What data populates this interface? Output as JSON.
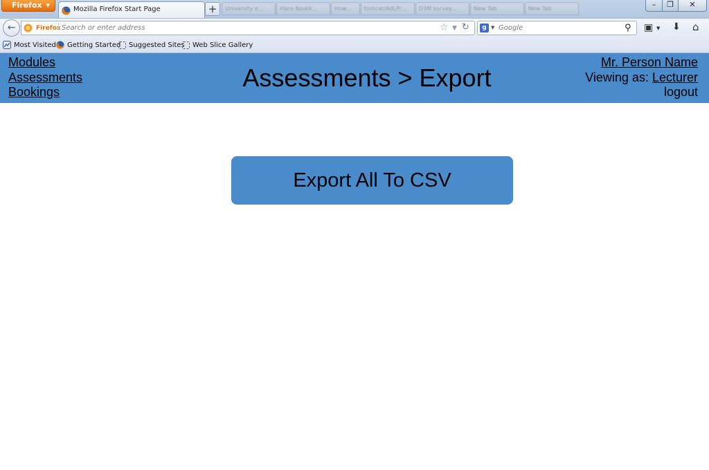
{
  "browser": {
    "menu_button_label": "Firefox",
    "active_tab_title": "Mozilla Firefox Start Page",
    "background_tabs": [
      "University o...",
      "Hans Koukk...",
      "How...",
      "tomcat/AdLPr...",
      "D3M survey...",
      "New Tab",
      "New Tab"
    ],
    "identity_label": "Firefox",
    "url_placeholder": "Search or enter address",
    "search_placeholder": "Google",
    "search_engine_letter": "g",
    "bookmarks": [
      "Most Visited",
      "Getting Started",
      "Suggested Sites",
      "Web Slice Gallery"
    ]
  },
  "header": {
    "nav": [
      "Modules",
      "Assessments",
      "Bookings"
    ],
    "title": "Assessments > Export",
    "user_name": "Mr. Person Name",
    "viewing_as_prefix": "Viewing as: ",
    "viewing_as_role": "Lecturer",
    "logout_label": "logout"
  },
  "main": {
    "export_button_label": "Export All To CSV"
  },
  "colors": {
    "accent": "#4a8ccb",
    "firefox_orange": "#e36c0a"
  }
}
